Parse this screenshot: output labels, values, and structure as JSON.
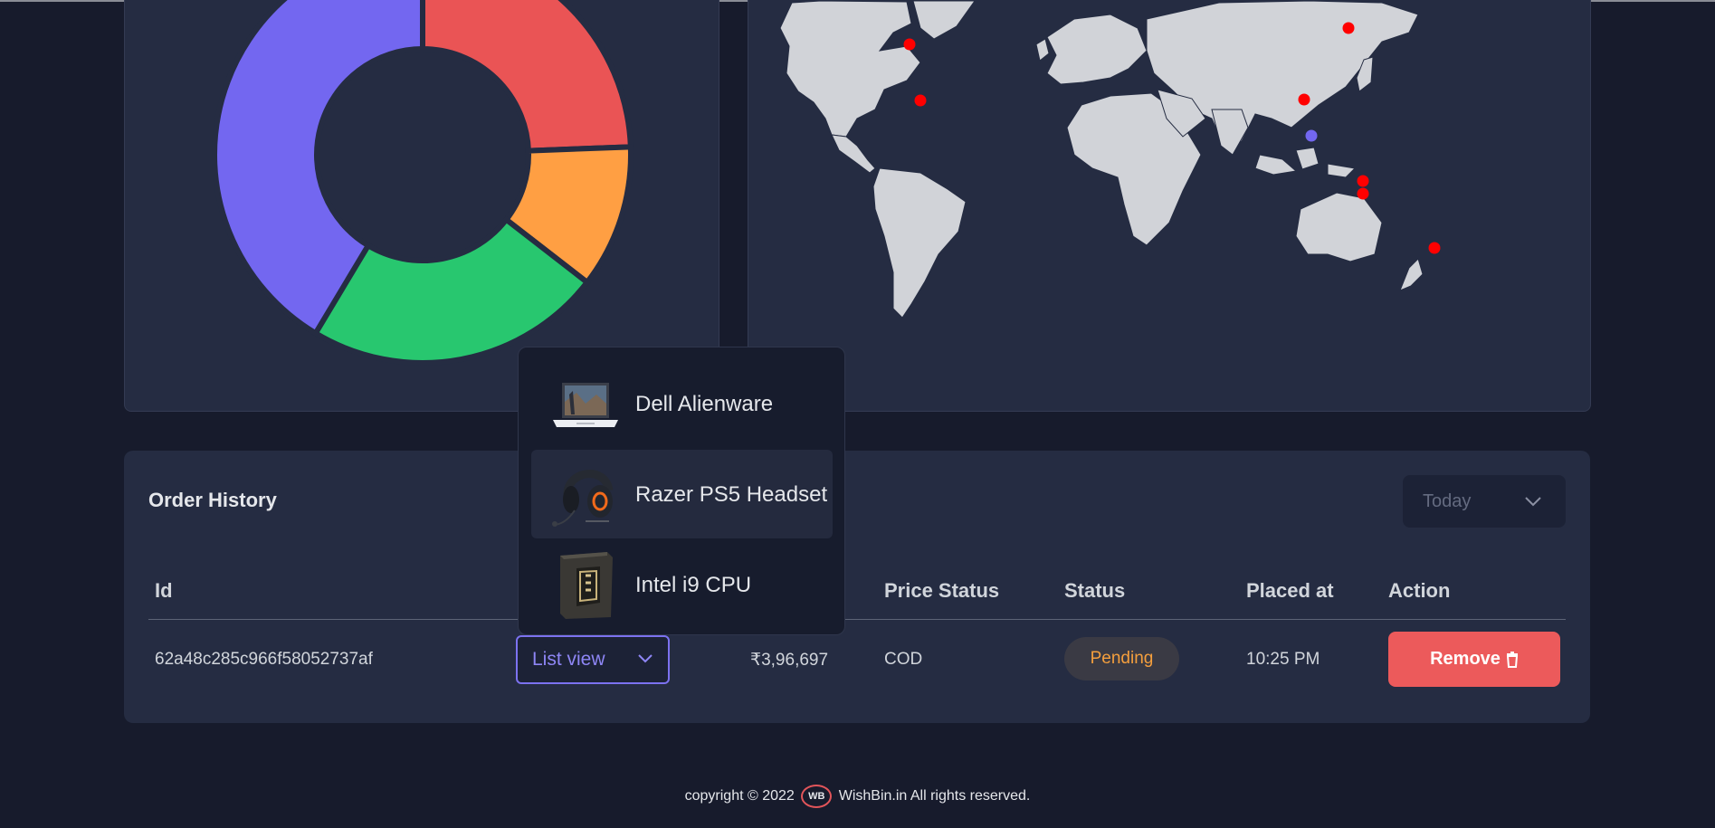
{
  "chart_data": {
    "type": "pie",
    "categories": [
      "",
      "",
      "",
      ""
    ],
    "values": [
      0.244,
      0.111,
      0.231,
      0.414
    ],
    "colors": [
      "#ea5455",
      "#ff9f43",
      "#28c76f",
      "#7367f0"
    ]
  },
  "map": {
    "marker_color": "#ff0000",
    "highlight_color": "#7367f0",
    "land_color": "#d1d3d8"
  },
  "orders": {
    "title": "Order History",
    "range_select": "Today",
    "columns": [
      "Id",
      "Price Status",
      "Status",
      "Placed at",
      "Action"
    ],
    "rows": [
      {
        "id": "62a48c285c966f58052737af",
        "items_button": "List view",
        "amount": "₹3,96,697",
        "price_status": "COD",
        "status": "Pending",
        "placed_at": "10:25 PM",
        "action": "Remove"
      }
    ],
    "items": [
      {
        "name": "Dell Alienware"
      },
      {
        "name": "Razer PS5 Headset"
      },
      {
        "name": "Intel i9 CPU"
      }
    ]
  },
  "footer": {
    "copyright": "copyright © 2022",
    "logo": "WB",
    "brand_text": "WishBin.in All rights reserved."
  },
  "colors": {
    "background": "#171b2c",
    "card": "#252c42",
    "accent": "#7367f0",
    "danger": "#ea5455",
    "warning": "#ff9f43"
  }
}
